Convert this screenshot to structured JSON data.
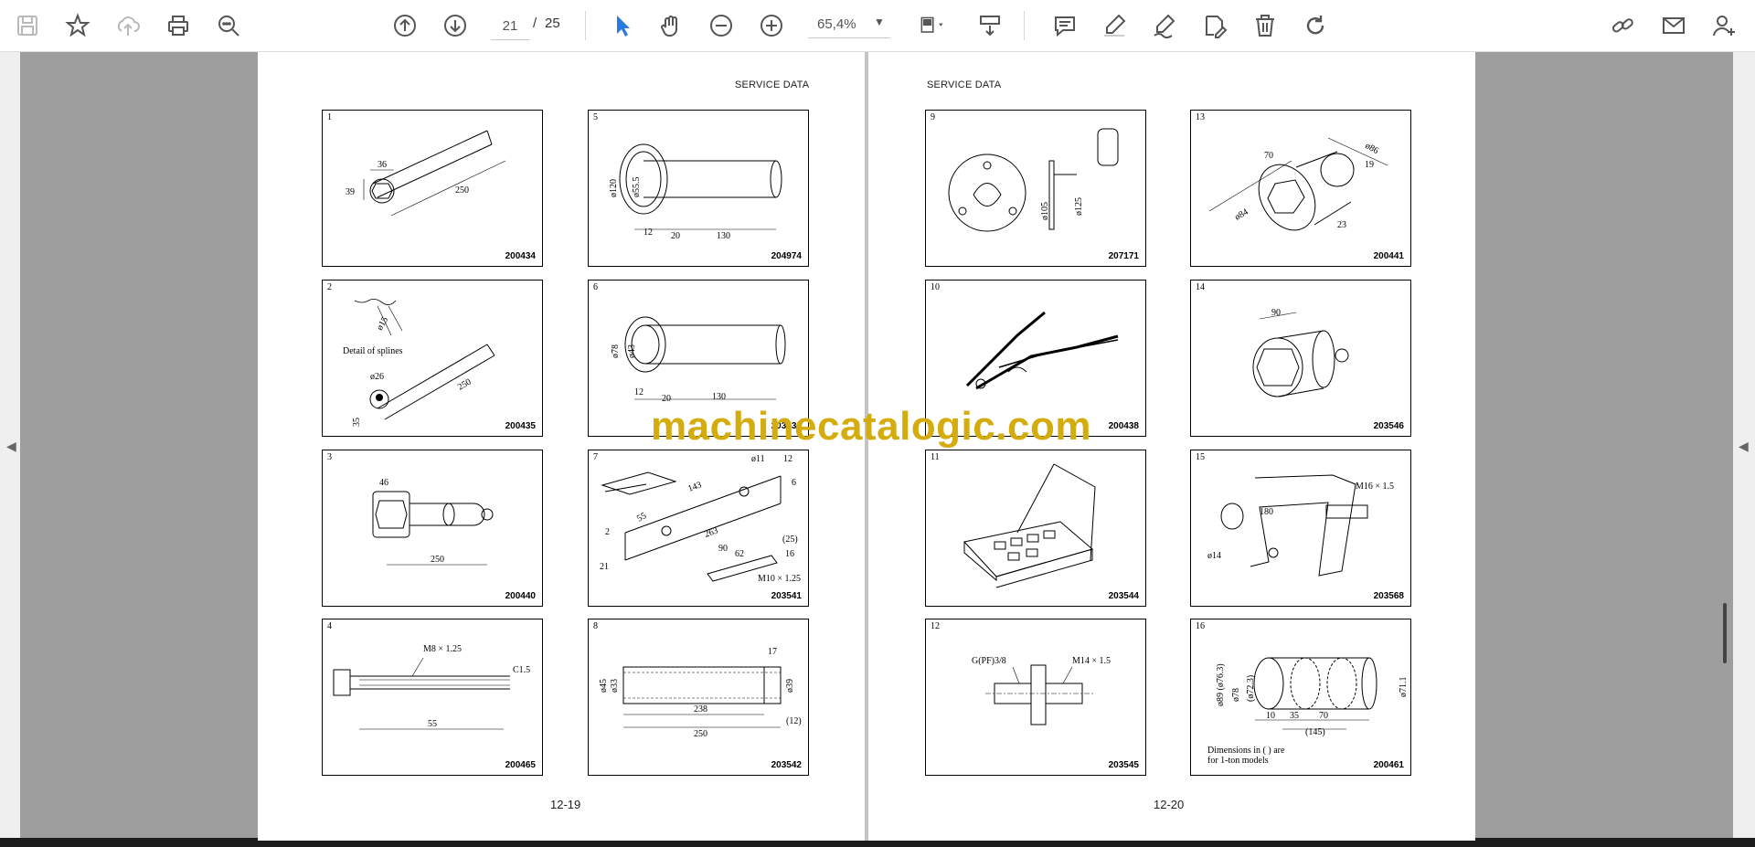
{
  "toolbar": {
    "icons": [
      "save-icon",
      "bookmark-star-icon",
      "upload-cloud-icon",
      "print-icon",
      "zoom-search-icon",
      "page-up-icon",
      "page-down-icon",
      "select-cursor-icon",
      "hand-tool-icon",
      "zoom-out-icon",
      "zoom-in-icon",
      "page-fit-icon",
      "scroll-mode-icon",
      "comment-icon",
      "highlight-pen-icon",
      "draw-icon",
      "sign-icon",
      "delete-icon",
      "rotate-icon",
      "link-icon",
      "mail-icon",
      "add-user-icon"
    ],
    "page_current": "21",
    "page_separator": "/",
    "page_total": "25",
    "zoom": "65,4%",
    "accent_color": "#2a7ae4"
  },
  "document": {
    "left_page": {
      "header": "SERVICE DATA",
      "footer": "12-19",
      "cells": [
        {
          "num": "1",
          "code": "200434",
          "labels": [
            "36",
            "39",
            "250"
          ]
        },
        {
          "num": "5",
          "code": "204974",
          "labels": [
            "ø120",
            "ø55.5",
            "12",
            "20",
            "130"
          ]
        },
        {
          "num": "2",
          "code": "200435",
          "labels": [
            "Detail of splines",
            "ø26",
            "35",
            "250",
            "ø15"
          ]
        },
        {
          "num": "6",
          "code": "203536",
          "labels": [
            "ø78",
            "ø43",
            "12",
            "20",
            "130"
          ]
        },
        {
          "num": "3",
          "code": "200440",
          "labels": [
            "46",
            "250"
          ]
        },
        {
          "num": "7",
          "code": "203541",
          "labels": [
            "ø11",
            "12",
            "6",
            "55",
            "143",
            "263",
            "2",
            "21",
            "(25)",
            "16",
            "90",
            "62",
            "M10 × 1.25"
          ]
        },
        {
          "num": "4",
          "code": "200465",
          "labels": [
            "M8 × 1.25",
            "C1.5",
            "55"
          ]
        },
        {
          "num": "8",
          "code": "203542",
          "labels": [
            "17",
            "ø45",
            "ø33",
            "ø39",
            "238",
            "250",
            "(12)"
          ]
        }
      ]
    },
    "right_page": {
      "header": "SERVICE DATA",
      "footer": "12-20",
      "cells": [
        {
          "num": "9",
          "code": "207171",
          "labels": [
            "ø105",
            "ø125"
          ]
        },
        {
          "num": "13",
          "code": "200441",
          "labels": [
            "70",
            "ø86",
            "19",
            "ø84",
            "23"
          ]
        },
        {
          "num": "10",
          "code": "200438",
          "labels": []
        },
        {
          "num": "14",
          "code": "203546",
          "labels": [
            "90"
          ]
        },
        {
          "num": "11",
          "code": "203544",
          "labels": []
        },
        {
          "num": "15",
          "code": "203568",
          "labels": [
            "M16 × 1.5",
            "180",
            "ø14"
          ]
        },
        {
          "num": "12",
          "code": "203545",
          "labels": [
            "G(PF)3/8",
            "M14 × 1.5"
          ]
        },
        {
          "num": "16",
          "code": "200461",
          "labels": [
            "ø89 (ø76.3)",
            "ø78",
            "(ø72.3)",
            "ø71.1",
            "10",
            "35",
            "70",
            "(145)",
            "Dimensions in ( ) are",
            "for 1-ton models"
          ]
        }
      ]
    }
  },
  "watermark": "machinecatalogic.com"
}
